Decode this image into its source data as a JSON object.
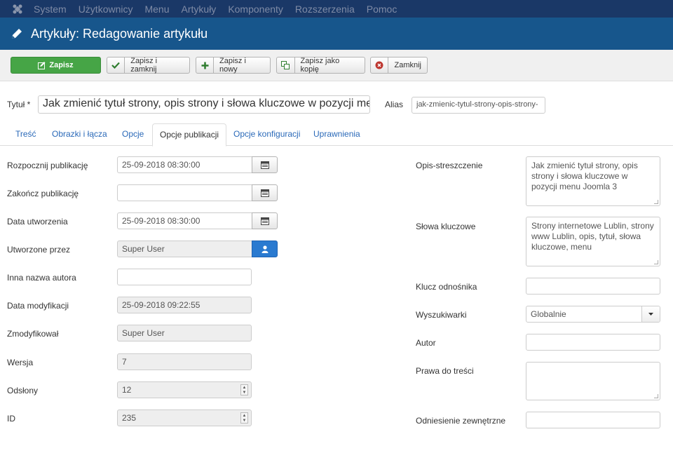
{
  "topmenu": {
    "items": [
      "System",
      "Użytkownicy",
      "Menu",
      "Artykuły",
      "Komponenty",
      "Rozszerzenia",
      "Pomoc"
    ]
  },
  "header": {
    "title": "Artykuły: Redagowanie artykułu"
  },
  "toolbar": {
    "save": "Zapisz",
    "save_close": "Zapisz i zamknij",
    "save_new": "Zapisz i nowy",
    "save_copy": "Zapisz jako kopię",
    "close": "Zamknij"
  },
  "form": {
    "title_label": "Tytuł *",
    "title_value": "Jak zmienić tytuł strony, opis strony i słowa kluczowe w pozycji me",
    "alias_label": "Alias",
    "alias_value": "jak-zmienic-tytul-strony-opis-strony-"
  },
  "tabs": [
    "Treść",
    "Obrazki i łącza",
    "Opcje",
    "Opcje publikacji",
    "Opcje konfiguracji",
    "Uprawnienia"
  ],
  "left": {
    "publish_up_label": "Rozpocznij publikację",
    "publish_up_value": "25-09-2018 08:30:00",
    "publish_down_label": "Zakończ publikację",
    "publish_down_value": "",
    "created_label": "Data utworzenia",
    "created_value": "25-09-2018 08:30:00",
    "created_by_label": "Utworzone przez",
    "created_by_value": "Super User",
    "alias_author_label": "Inna nazwa autora",
    "alias_author_value": "",
    "modified_label": "Data modyfikacji",
    "modified_value": "25-09-2018 09:22:55",
    "modified_by_label": "Zmodyfikował",
    "modified_by_value": "Super User",
    "version_label": "Wersja",
    "version_value": "7",
    "hits_label": "Odsłony",
    "hits_value": "12",
    "id_label": "ID",
    "id_value": "235"
  },
  "right": {
    "metadesc_label": "Opis-streszczenie",
    "metadesc_value": "Jak zmienić tytuł strony, opis strony i słowa kluczowe w pozycji menu Joomla 3",
    "metakey_label": "Słowa kluczowe",
    "metakey_value": "Strony internetowe Lublin, strony www Lublin, opis, tytuł, słowa kluczowe, menu",
    "xreference_label": "Klucz odnośnika",
    "xreference_value": "",
    "robots_label": "Wyszukiwarki",
    "robots_value": "Globalnie",
    "author_label": "Autor",
    "author_value": "",
    "rights_label": "Prawa do treści",
    "rights_value": "",
    "external_label": "Odniesienie zewnętrzne",
    "external_value": ""
  },
  "colors": {
    "topbar": "#1a3867",
    "titlebar": "#17568c",
    "save": "#46a546",
    "link": "#2a69b8"
  }
}
